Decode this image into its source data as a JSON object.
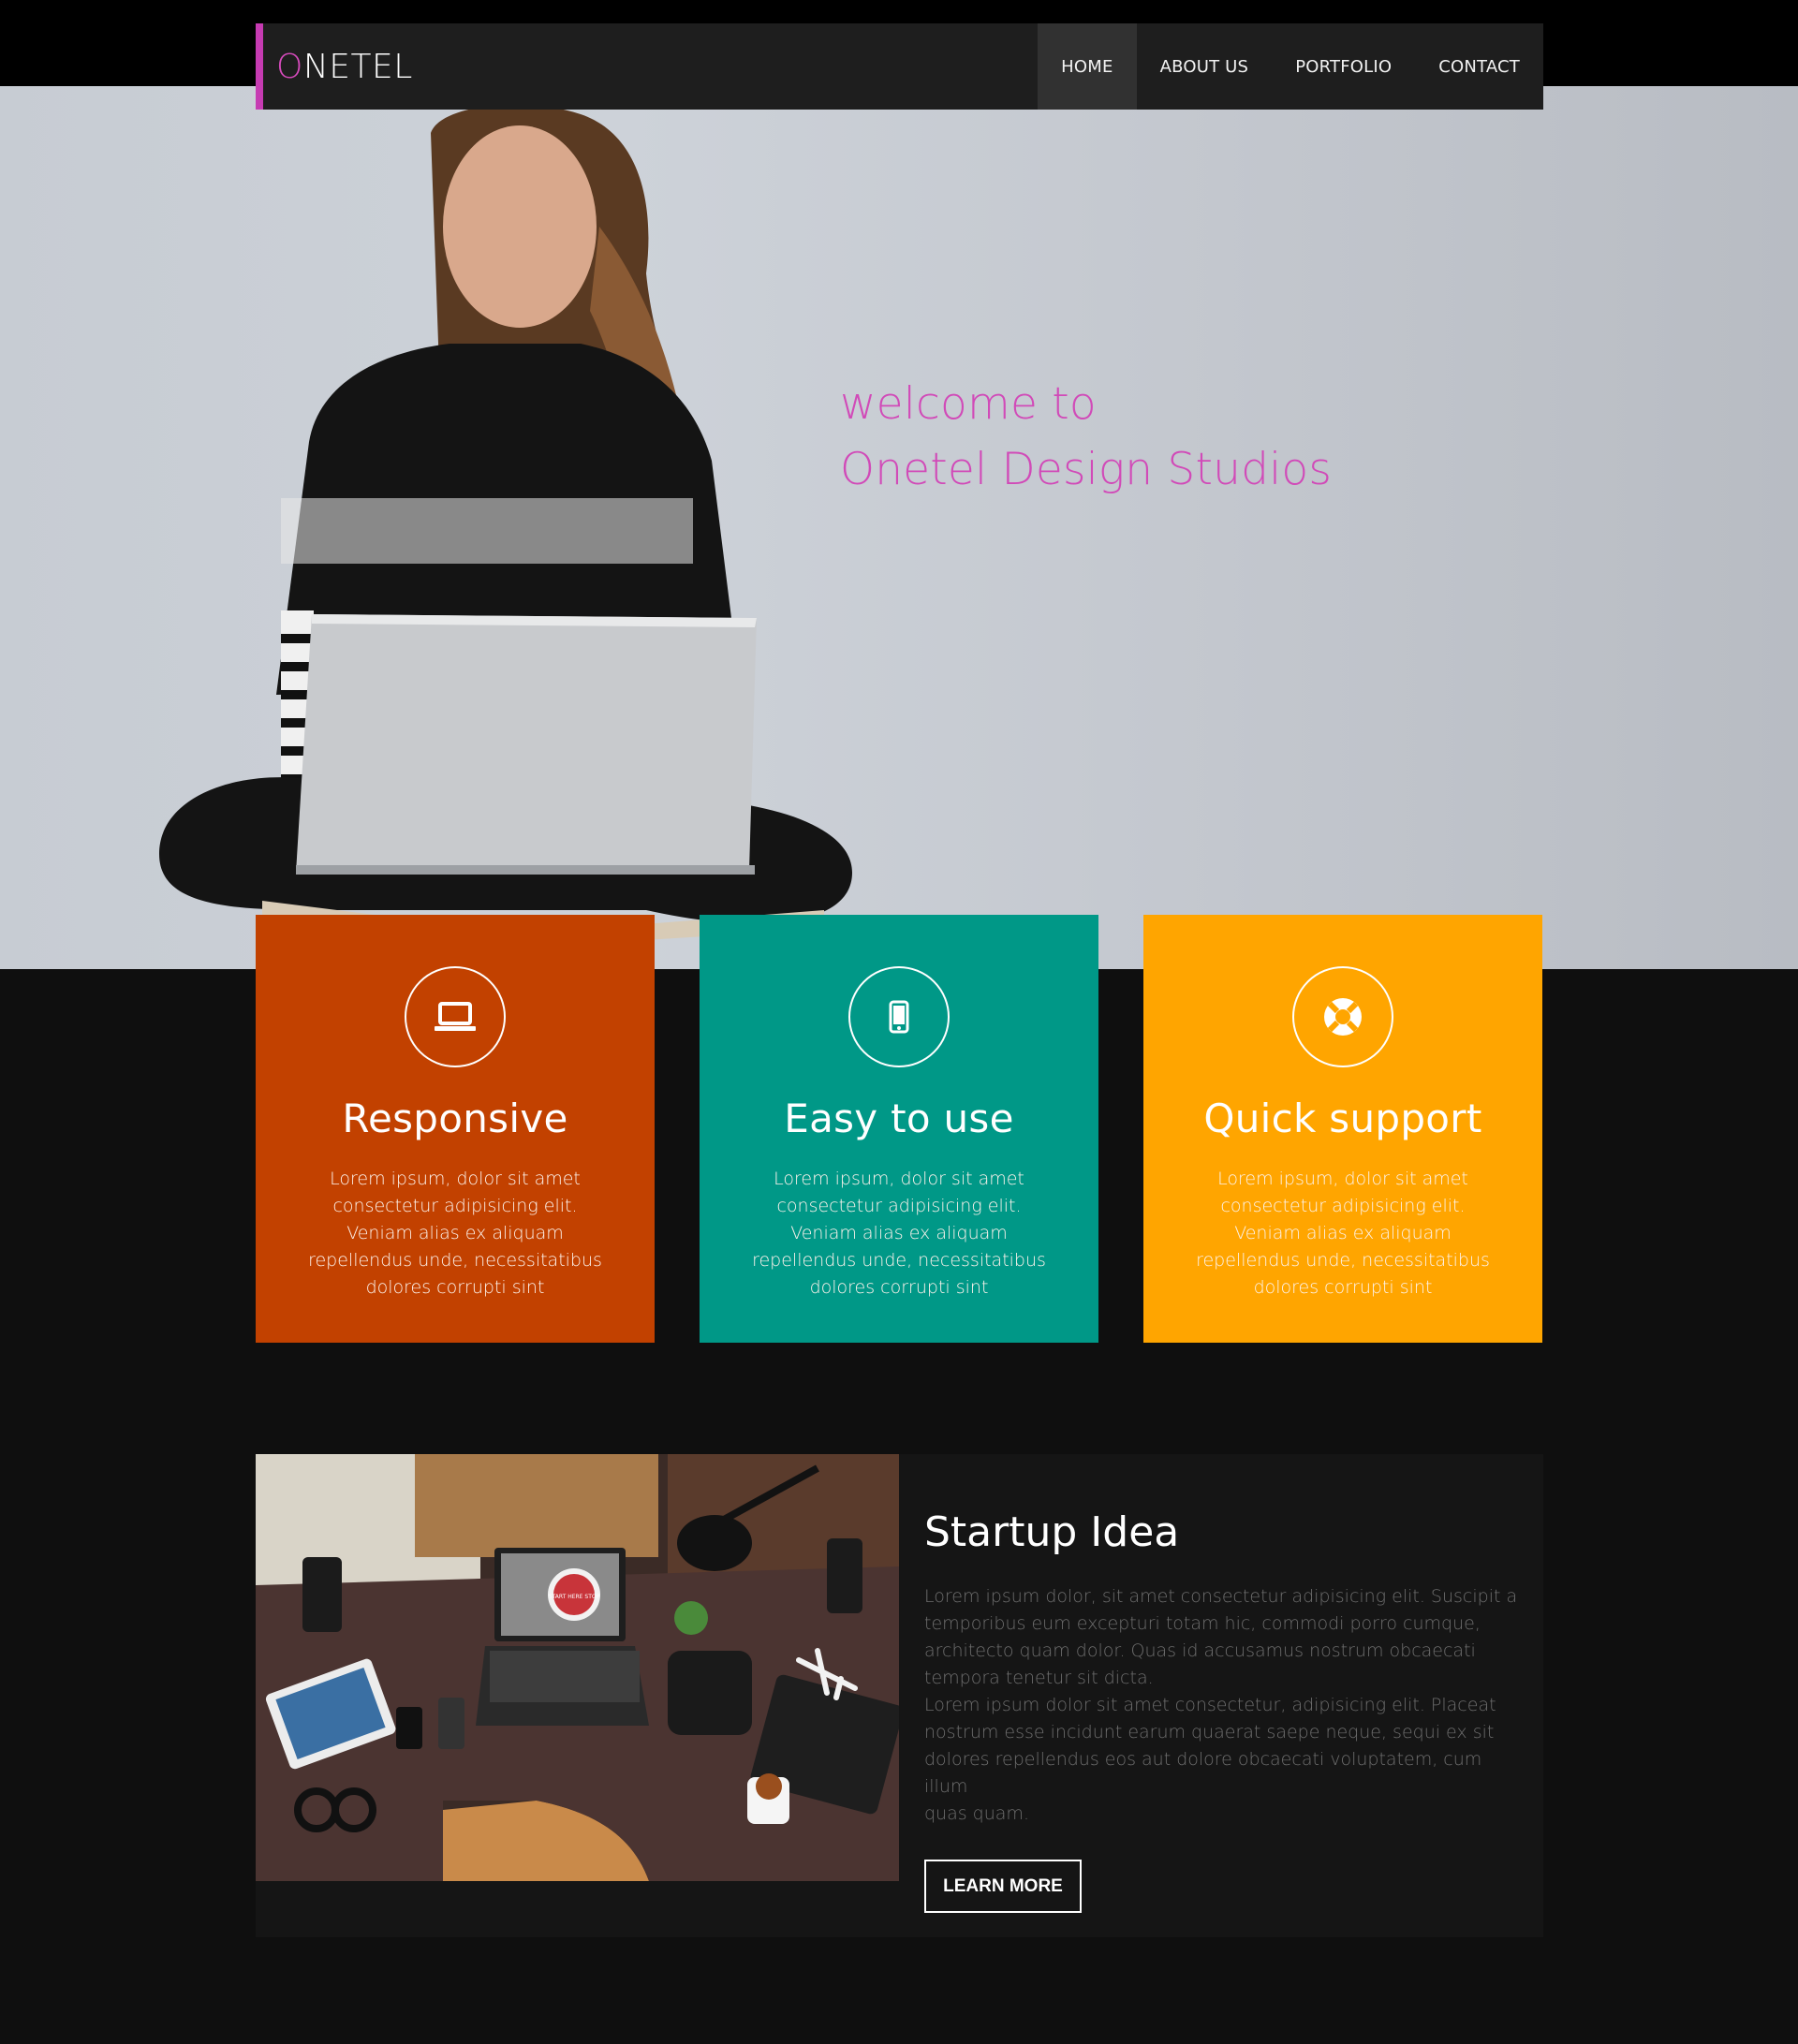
{
  "colors": {
    "brand_accent": "#d14ab8",
    "nav_bg": "#1e1e1e",
    "card_responsive": "#c24100",
    "card_easy": "#009887",
    "card_support": "#ffa500",
    "page_bg": "#0f0f0f"
  },
  "header": {
    "logo_initial": "O",
    "logo_rest": "NETEL",
    "nav": [
      {
        "label": "HOME",
        "active": true
      },
      {
        "label": "ABOUT US",
        "active": false
      },
      {
        "label": "PORTFOLIO",
        "active": false
      },
      {
        "label": "CONTACT",
        "active": false
      }
    ]
  },
  "hero": {
    "line1": "welcome to",
    "line2": "Onetel Design Studios"
  },
  "features": [
    {
      "icon": "laptop-icon",
      "title": "Responsive",
      "lines": [
        "Lorem ipsum, dolor sit amet",
        "consectetur adipisicing elit.",
        "Veniam alias ex aliquam",
        "repellendus unde, necessitatibus",
        "dolores corrupti sint"
      ]
    },
    {
      "icon": "mobile-icon",
      "title": "Easy to use",
      "lines": [
        "Lorem ipsum, dolor sit amet",
        "consectetur adipisicing elit.",
        "Veniam alias ex aliquam",
        "repellendus unde, necessitatibus",
        "dolores corrupti sint"
      ]
    },
    {
      "icon": "lifebuoy-icon",
      "title": "Quick support",
      "lines": [
        "Lorem ipsum, dolor sit amet",
        "consectetur adipisicing elit.",
        "Veniam alias ex aliquam",
        "repellendus unde, necessitatibus",
        "dolores corrupti sint"
      ]
    }
  ],
  "startup": {
    "title": "Startup Idea",
    "lines": [
      "Lorem ipsum dolor, sit amet consectetur adipisicing elit. Suscipit a",
      "temporibus eum excepturi totam hic, commodi porro cumque,",
      "architecto quam dolor. Quas id accusamus nostrum obcaecati",
      "tempora tenetur sit dicta.",
      "Lorem ipsum dolor sit amet consectetur, adipisicing elit. Placeat",
      "nostrum esse incidunt earum quaerat saepe neque, sequi ex sit",
      "dolores repellendus eos aut dolore obcaecati voluptatem, cum illum",
      "quas quam."
    ],
    "button_label": "LEARN MORE",
    "sticker_text": "START HERE STOP"
  }
}
